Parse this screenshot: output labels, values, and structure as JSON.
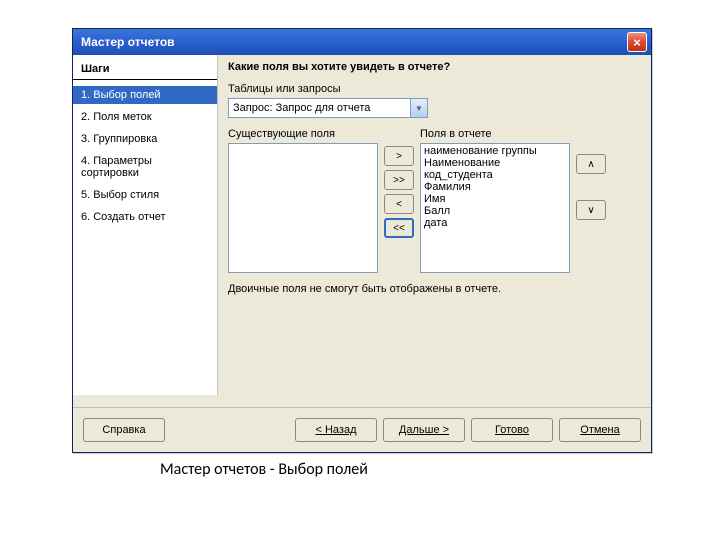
{
  "titlebar": {
    "title": "Мастер отчетов"
  },
  "sidebar": {
    "header": "Шаги",
    "items": [
      {
        "label": "1. Выбор полей",
        "active": true
      },
      {
        "label": "2. Поля меток",
        "active": false
      },
      {
        "label": "3. Группировка",
        "active": false
      },
      {
        "label": "4. Параметры сортировки",
        "active": false
      },
      {
        "label": "5. Выбор стиля",
        "active": false
      },
      {
        "label": "6. Создать отчет",
        "active": false
      }
    ]
  },
  "main": {
    "header": "Какие поля вы хотите увидеть в отчете?",
    "tables_label": "Таблицы или запросы",
    "combo_value": "Запрос: Запрос для отчета",
    "available_label": "Существующие поля",
    "selected_label": "Поля в отчете",
    "available_items": [],
    "selected_items": [
      "наименование группы",
      "Наименование",
      "код_студента",
      "Фамилия",
      "Имя",
      "Балл",
      "дата"
    ],
    "note": "Двоичные поля не смогут быть отображены в отчете."
  },
  "move_buttons": {
    "add": ">",
    "add_all": ">>",
    "remove": "<",
    "remove_all": "<<",
    "up": "∧",
    "down": "∨"
  },
  "buttons": {
    "help": "Справка",
    "back": "< Назад",
    "next": "Дальше >",
    "finish": "Готово",
    "cancel": "Отмена"
  },
  "caption": "Мастер отчетов - Выбор полей"
}
